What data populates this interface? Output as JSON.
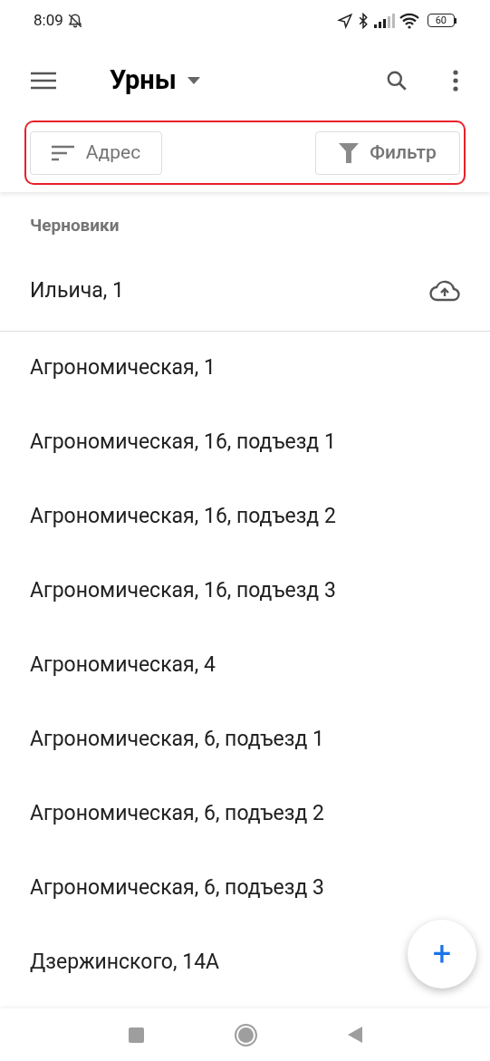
{
  "status_bar": {
    "time": "8:09",
    "battery": "60"
  },
  "app_bar": {
    "title": "Урны"
  },
  "toolbar": {
    "sort_label": "Адрес",
    "filter_label": "Фильтр"
  },
  "drafts": {
    "title": "Черновики",
    "items": [
      {
        "label": "Ильича, 1"
      }
    ]
  },
  "items": [
    {
      "label": "Агрономическая, 1"
    },
    {
      "label": "Агрономическая, 16, подъезд 1"
    },
    {
      "label": "Агрономическая, 16, подъезд 2"
    },
    {
      "label": "Агрономическая, 16, подъезд 3"
    },
    {
      "label": "Агрономическая, 4"
    },
    {
      "label": "Агрономическая, 6, подъезд 1"
    },
    {
      "label": "Агрономическая, 6, подъезд 2"
    },
    {
      "label": "Агрономическая, 6, подъезд 3"
    },
    {
      "label": "Дзержинского, 14А"
    }
  ],
  "fab": {
    "label": "+"
  }
}
